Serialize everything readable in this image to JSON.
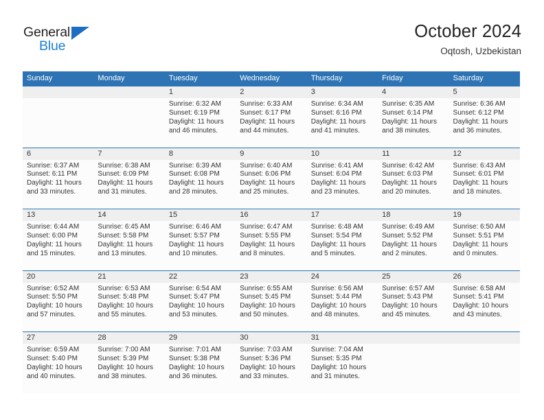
{
  "brand": {
    "name_part1": "General",
    "name_part2": "Blue",
    "triangle_color": "#1b6ec2",
    "blue_text_color": "#1b7fd4"
  },
  "header": {
    "title": "October 2024",
    "subtitle": "Oqtosh, Uzbekistan"
  },
  "theme": {
    "header_row_bg": "#2e74b5",
    "day_head_bg": "#efefef",
    "cell_bg": "#fcfcfc",
    "text_color": "#333333"
  },
  "weekday_headers": [
    "Sunday",
    "Monday",
    "Tuesday",
    "Wednesday",
    "Thursday",
    "Friday",
    "Saturday"
  ],
  "weeks": [
    [
      {
        "day": "",
        "sunrise": "",
        "sunset": "",
        "daylight_line1": "",
        "daylight_line2": ""
      },
      {
        "day": "",
        "sunrise": "",
        "sunset": "",
        "daylight_line1": "",
        "daylight_line2": ""
      },
      {
        "day": "1",
        "sunrise": "Sunrise: 6:32 AM",
        "sunset": "Sunset: 6:19 PM",
        "daylight_line1": "Daylight: 11 hours",
        "daylight_line2": "and 46 minutes."
      },
      {
        "day": "2",
        "sunrise": "Sunrise: 6:33 AM",
        "sunset": "Sunset: 6:17 PM",
        "daylight_line1": "Daylight: 11 hours",
        "daylight_line2": "and 44 minutes."
      },
      {
        "day": "3",
        "sunrise": "Sunrise: 6:34 AM",
        "sunset": "Sunset: 6:16 PM",
        "daylight_line1": "Daylight: 11 hours",
        "daylight_line2": "and 41 minutes."
      },
      {
        "day": "4",
        "sunrise": "Sunrise: 6:35 AM",
        "sunset": "Sunset: 6:14 PM",
        "daylight_line1": "Daylight: 11 hours",
        "daylight_line2": "and 38 minutes."
      },
      {
        "day": "5",
        "sunrise": "Sunrise: 6:36 AM",
        "sunset": "Sunset: 6:12 PM",
        "daylight_line1": "Daylight: 11 hours",
        "daylight_line2": "and 36 minutes."
      }
    ],
    [
      {
        "day": "6",
        "sunrise": "Sunrise: 6:37 AM",
        "sunset": "Sunset: 6:11 PM",
        "daylight_line1": "Daylight: 11 hours",
        "daylight_line2": "and 33 minutes."
      },
      {
        "day": "7",
        "sunrise": "Sunrise: 6:38 AM",
        "sunset": "Sunset: 6:09 PM",
        "daylight_line1": "Daylight: 11 hours",
        "daylight_line2": "and 31 minutes."
      },
      {
        "day": "8",
        "sunrise": "Sunrise: 6:39 AM",
        "sunset": "Sunset: 6:08 PM",
        "daylight_line1": "Daylight: 11 hours",
        "daylight_line2": "and 28 minutes."
      },
      {
        "day": "9",
        "sunrise": "Sunrise: 6:40 AM",
        "sunset": "Sunset: 6:06 PM",
        "daylight_line1": "Daylight: 11 hours",
        "daylight_line2": "and 25 minutes."
      },
      {
        "day": "10",
        "sunrise": "Sunrise: 6:41 AM",
        "sunset": "Sunset: 6:04 PM",
        "daylight_line1": "Daylight: 11 hours",
        "daylight_line2": "and 23 minutes."
      },
      {
        "day": "11",
        "sunrise": "Sunrise: 6:42 AM",
        "sunset": "Sunset: 6:03 PM",
        "daylight_line1": "Daylight: 11 hours",
        "daylight_line2": "and 20 minutes."
      },
      {
        "day": "12",
        "sunrise": "Sunrise: 6:43 AM",
        "sunset": "Sunset: 6:01 PM",
        "daylight_line1": "Daylight: 11 hours",
        "daylight_line2": "and 18 minutes."
      }
    ],
    [
      {
        "day": "13",
        "sunrise": "Sunrise: 6:44 AM",
        "sunset": "Sunset: 6:00 PM",
        "daylight_line1": "Daylight: 11 hours",
        "daylight_line2": "and 15 minutes."
      },
      {
        "day": "14",
        "sunrise": "Sunrise: 6:45 AM",
        "sunset": "Sunset: 5:58 PM",
        "daylight_line1": "Daylight: 11 hours",
        "daylight_line2": "and 13 minutes."
      },
      {
        "day": "15",
        "sunrise": "Sunrise: 6:46 AM",
        "sunset": "Sunset: 5:57 PM",
        "daylight_line1": "Daylight: 11 hours",
        "daylight_line2": "and 10 minutes."
      },
      {
        "day": "16",
        "sunrise": "Sunrise: 6:47 AM",
        "sunset": "Sunset: 5:55 PM",
        "daylight_line1": "Daylight: 11 hours",
        "daylight_line2": "and 8 minutes."
      },
      {
        "day": "17",
        "sunrise": "Sunrise: 6:48 AM",
        "sunset": "Sunset: 5:54 PM",
        "daylight_line1": "Daylight: 11 hours",
        "daylight_line2": "and 5 minutes."
      },
      {
        "day": "18",
        "sunrise": "Sunrise: 6:49 AM",
        "sunset": "Sunset: 5:52 PM",
        "daylight_line1": "Daylight: 11 hours",
        "daylight_line2": "and 2 minutes."
      },
      {
        "day": "19",
        "sunrise": "Sunrise: 6:50 AM",
        "sunset": "Sunset: 5:51 PM",
        "daylight_line1": "Daylight: 11 hours",
        "daylight_line2": "and 0 minutes."
      }
    ],
    [
      {
        "day": "20",
        "sunrise": "Sunrise: 6:52 AM",
        "sunset": "Sunset: 5:50 PM",
        "daylight_line1": "Daylight: 10 hours",
        "daylight_line2": "and 57 minutes."
      },
      {
        "day": "21",
        "sunrise": "Sunrise: 6:53 AM",
        "sunset": "Sunset: 5:48 PM",
        "daylight_line1": "Daylight: 10 hours",
        "daylight_line2": "and 55 minutes."
      },
      {
        "day": "22",
        "sunrise": "Sunrise: 6:54 AM",
        "sunset": "Sunset: 5:47 PM",
        "daylight_line1": "Daylight: 10 hours",
        "daylight_line2": "and 53 minutes."
      },
      {
        "day": "23",
        "sunrise": "Sunrise: 6:55 AM",
        "sunset": "Sunset: 5:45 PM",
        "daylight_line1": "Daylight: 10 hours",
        "daylight_line2": "and 50 minutes."
      },
      {
        "day": "24",
        "sunrise": "Sunrise: 6:56 AM",
        "sunset": "Sunset: 5:44 PM",
        "daylight_line1": "Daylight: 10 hours",
        "daylight_line2": "and 48 minutes."
      },
      {
        "day": "25",
        "sunrise": "Sunrise: 6:57 AM",
        "sunset": "Sunset: 5:43 PM",
        "daylight_line1": "Daylight: 10 hours",
        "daylight_line2": "and 45 minutes."
      },
      {
        "day": "26",
        "sunrise": "Sunrise: 6:58 AM",
        "sunset": "Sunset: 5:41 PM",
        "daylight_line1": "Daylight: 10 hours",
        "daylight_line2": "and 43 minutes."
      }
    ],
    [
      {
        "day": "27",
        "sunrise": "Sunrise: 6:59 AM",
        "sunset": "Sunset: 5:40 PM",
        "daylight_line1": "Daylight: 10 hours",
        "daylight_line2": "and 40 minutes."
      },
      {
        "day": "28",
        "sunrise": "Sunrise: 7:00 AM",
        "sunset": "Sunset: 5:39 PM",
        "daylight_line1": "Daylight: 10 hours",
        "daylight_line2": "and 38 minutes."
      },
      {
        "day": "29",
        "sunrise": "Sunrise: 7:01 AM",
        "sunset": "Sunset: 5:38 PM",
        "daylight_line1": "Daylight: 10 hours",
        "daylight_line2": "and 36 minutes."
      },
      {
        "day": "30",
        "sunrise": "Sunrise: 7:03 AM",
        "sunset": "Sunset: 5:36 PM",
        "daylight_line1": "Daylight: 10 hours",
        "daylight_line2": "and 33 minutes."
      },
      {
        "day": "31",
        "sunrise": "Sunrise: 7:04 AM",
        "sunset": "Sunset: 5:35 PM",
        "daylight_line1": "Daylight: 10 hours",
        "daylight_line2": "and 31 minutes."
      },
      {
        "day": "",
        "sunrise": "",
        "sunset": "",
        "daylight_line1": "",
        "daylight_line2": ""
      },
      {
        "day": "",
        "sunrise": "",
        "sunset": "",
        "daylight_line1": "",
        "daylight_line2": ""
      }
    ]
  ]
}
